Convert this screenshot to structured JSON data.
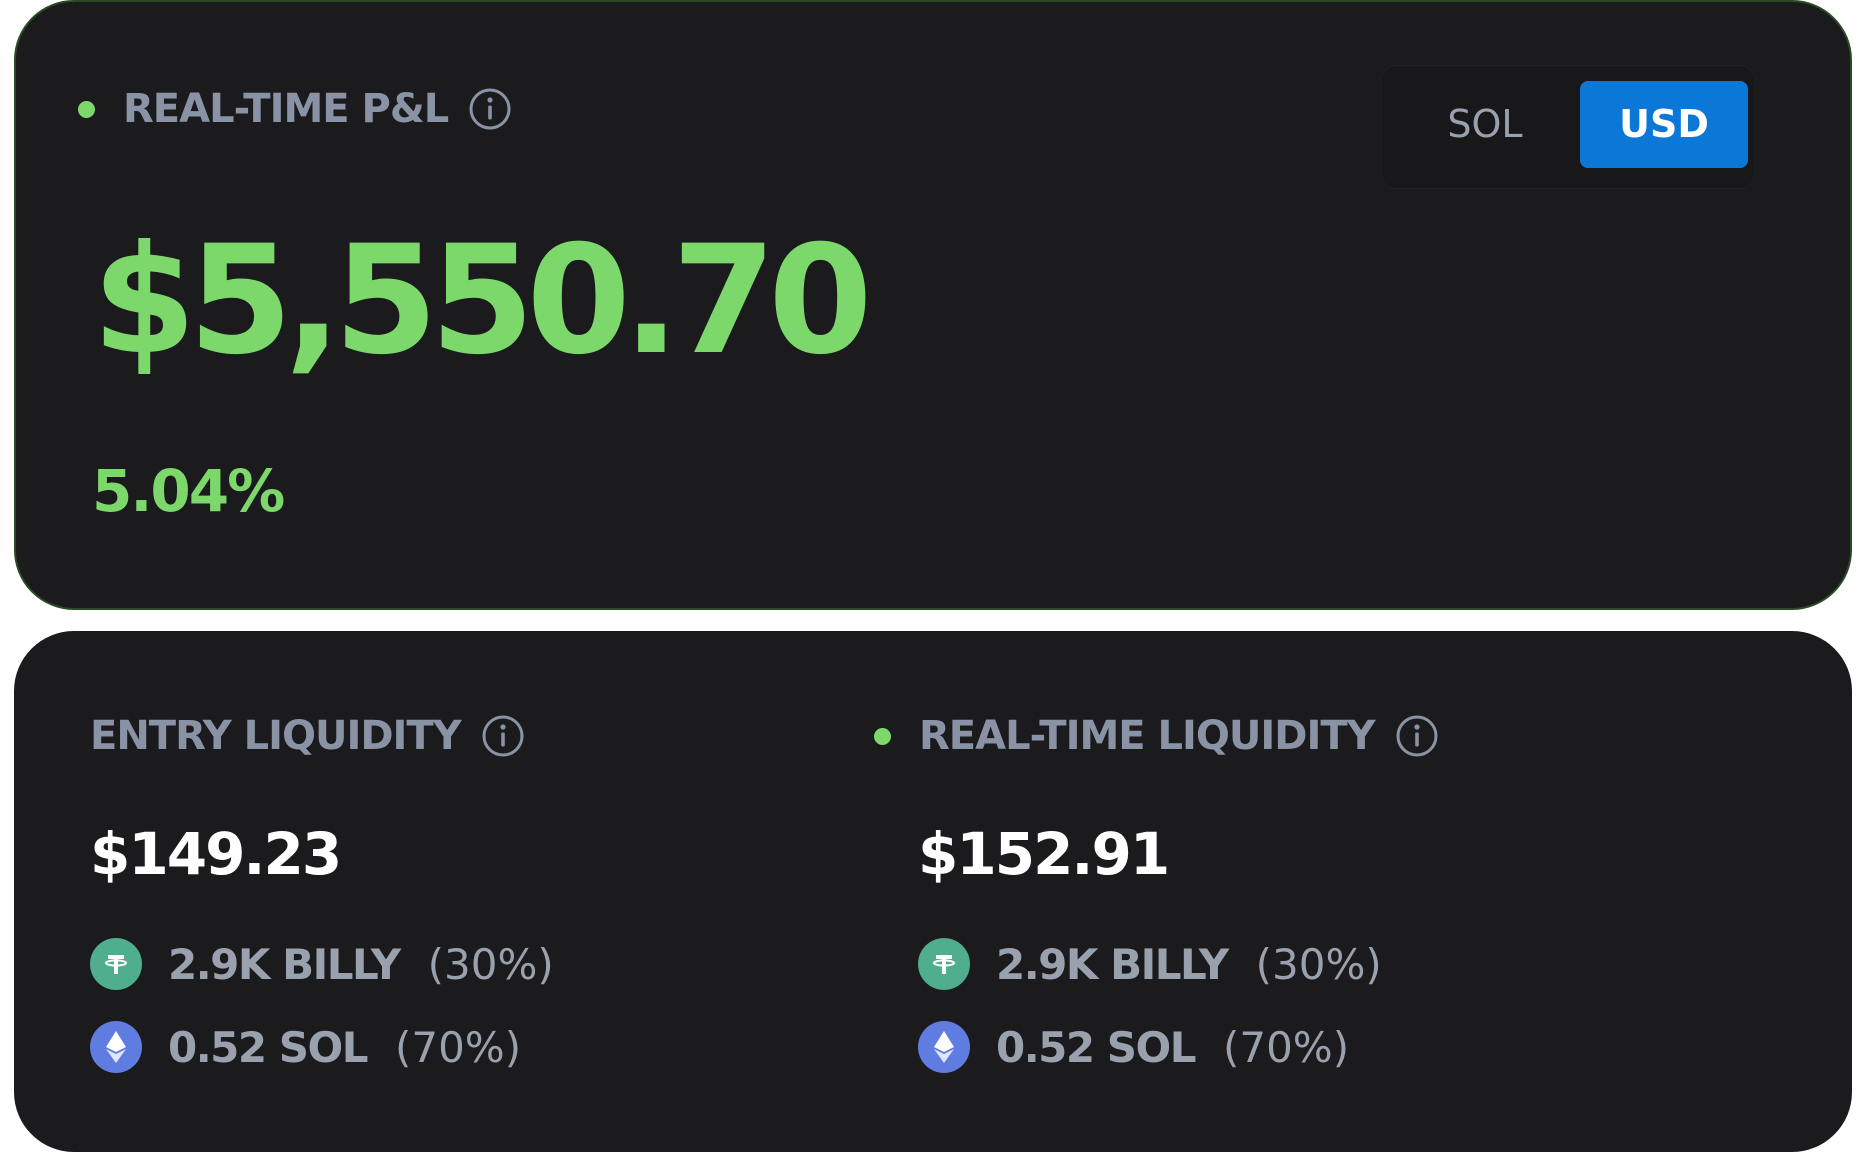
{
  "pnl_card": {
    "label": "REAL-TIME P&L",
    "value": "$5,550.70",
    "percent": "5.04%",
    "currency_toggle": {
      "options": [
        "SOL",
        "USD"
      ],
      "selected": "USD"
    }
  },
  "liquidity_card": {
    "entry": {
      "label": "ENTRY LIQUIDITY",
      "value": "$149.23",
      "tokens": [
        {
          "icon": "tether-icon",
          "amount": "2.9K BILLY",
          "percent": "(30%)"
        },
        {
          "icon": "ethereum-icon",
          "amount": "0.52 SOL",
          "percent": "(70%)"
        }
      ]
    },
    "realtime": {
      "label": "REAL-TIME LIQUIDITY",
      "value": "$152.91",
      "tokens": [
        {
          "icon": "tether-icon",
          "amount": "2.9K BILLY",
          "percent": "(30%)"
        },
        {
          "icon": "ethereum-icon",
          "amount": "0.52 SOL",
          "percent": "(70%)"
        }
      ]
    }
  },
  "colors": {
    "accent_green": "#7cd86b",
    "toggle_active": "#0b78d8",
    "card_bg": "#1b1b1d",
    "muted_text": "#8a93a6"
  }
}
